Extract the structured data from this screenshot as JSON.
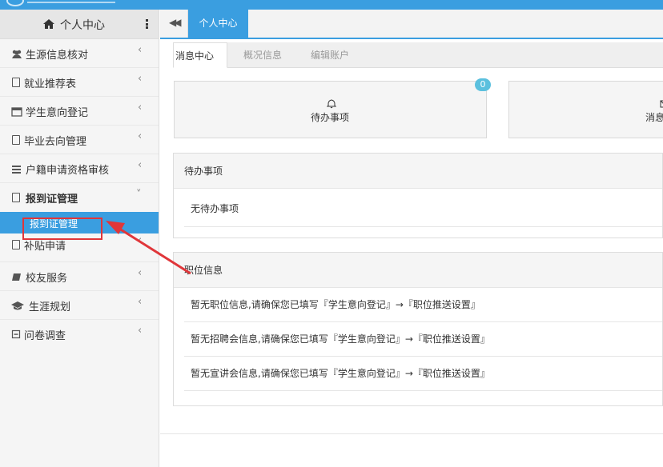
{
  "sidebar": {
    "header_title": "个人中心",
    "items": [
      {
        "label": "生源信息核对",
        "icon": "users-icon"
      },
      {
        "label": "就业推荐表",
        "icon": "document-icon"
      },
      {
        "label": "学生意向登记",
        "icon": "calendar-icon"
      },
      {
        "label": "毕业去向管理",
        "icon": "document-icon"
      },
      {
        "label": "户籍申请资格审核",
        "icon": "list-icon"
      },
      {
        "label": "报到证管理",
        "icon": "document-icon",
        "expanded": true
      },
      {
        "label": "补贴申请",
        "icon": "document-icon"
      },
      {
        "label": "校友服务",
        "icon": "book-icon"
      },
      {
        "label": "生涯规划",
        "icon": "graduation-cap-icon"
      },
      {
        "label": "问卷调查",
        "icon": "minus-square-icon"
      }
    ],
    "subitem_label": "报到证管理",
    "chevron_left": "‹",
    "chevron_down": "˅"
  },
  "tabstrip": {
    "back_glyph": "◀◀",
    "active_tab": "个人中心"
  },
  "main": {
    "tabs": [
      {
        "label": "消息中心",
        "active": true
      },
      {
        "label": "概况信息",
        "active": false
      },
      {
        "label": "编辑账户",
        "active": false
      }
    ],
    "cards": [
      {
        "label": "待办事项",
        "badge": "0",
        "icon": "bell-icon"
      },
      {
        "label": "消息",
        "icon": "envelope-icon"
      }
    ],
    "todo_panel": {
      "title": "待办事项",
      "rows": [
        "无待办事项"
      ]
    },
    "job_panel": {
      "title": "职位信息",
      "rows": [
        "暂无职位信息,请确保您已填写『学生意向登记』→『职位推送设置』",
        "暂无招聘会信息,请确保您已填写『学生意向登记』→『职位推送设置』",
        "暂无宣讲会信息,请确保您已填写『学生意向登记』→『职位推送设置』"
      ]
    }
  },
  "colors": {
    "accent": "#3a9ee0",
    "annotation": "#e0363a",
    "badge": "#5bc0de"
  }
}
